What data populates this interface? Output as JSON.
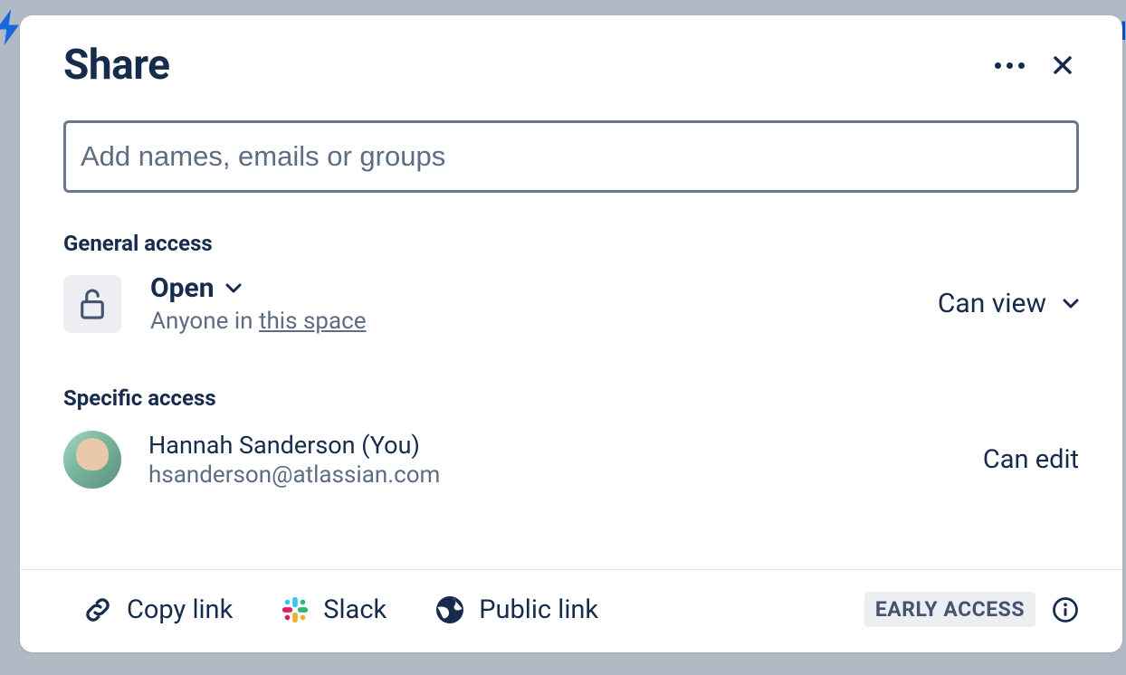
{
  "dialog": {
    "title": "Share",
    "input_placeholder": "Add names, emails or groups"
  },
  "general_access": {
    "label": "General access",
    "level": "Open",
    "sub_prefix": "Anyone in ",
    "sub_link": "this space",
    "permission": "Can view"
  },
  "specific_access": {
    "label": "Specific access",
    "user": {
      "name": "Hannah Sanderson (You)",
      "email": "hsanderson@atlassian.com",
      "permission": "Can edit"
    }
  },
  "footer": {
    "copy_link": "Copy link",
    "slack": "Slack",
    "public_link": "Public link",
    "badge": "EARLY ACCESS"
  }
}
